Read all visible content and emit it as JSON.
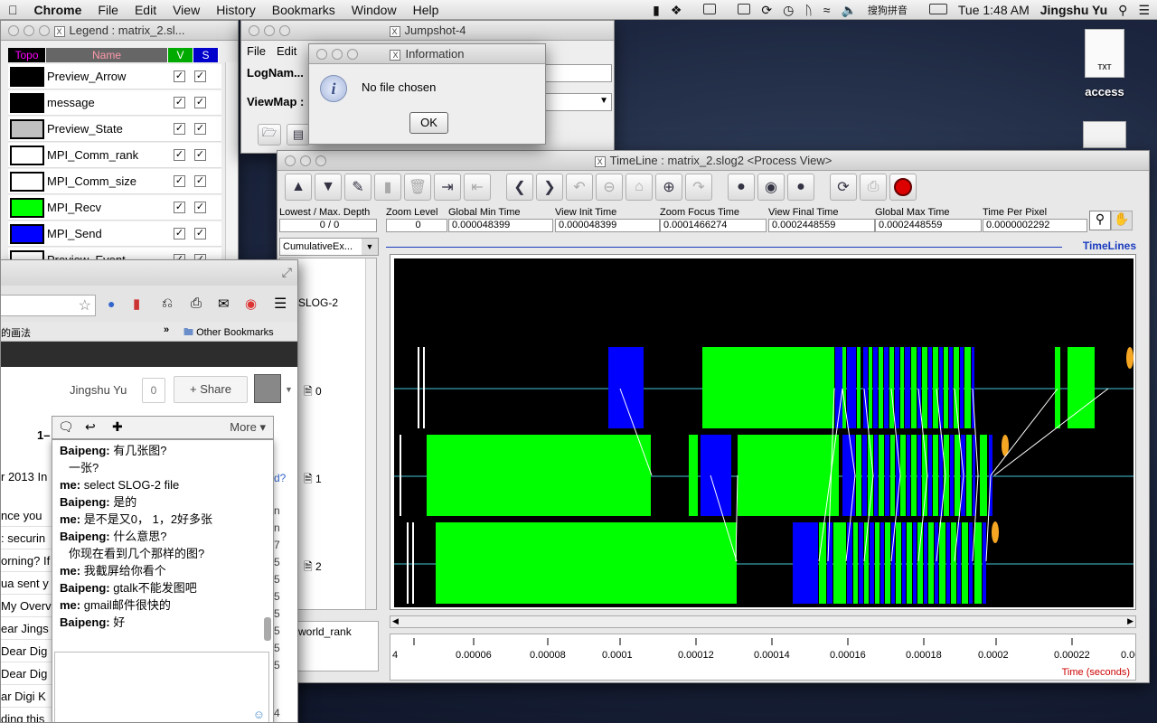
{
  "menubar": {
    "app": "Chrome",
    "items": [
      "File",
      "Edit",
      "View",
      "History",
      "Bookmarks",
      "Window",
      "Help"
    ],
    "right": {
      "input_method": "搜狗拼音",
      "time": "Tue 1:48 AM",
      "user": "Jingshu Yu"
    }
  },
  "desktop": {
    "icons": [
      {
        "label": "access",
        "type": "TXT"
      }
    ]
  },
  "legend": {
    "title": "Legend : matrix_2.sl...",
    "headers": {
      "topo": "Topo",
      "name": "Name",
      "v": "V",
      "s": "S"
    },
    "rows": [
      {
        "name": "Preview_Arrow",
        "color": "#000000"
      },
      {
        "name": "message",
        "color": "#000000"
      },
      {
        "name": "Preview_State",
        "color": "#c0c0c0"
      },
      {
        "name": "MPI_Comm_rank",
        "color": "#ffffff"
      },
      {
        "name": "MPI_Comm_size",
        "color": "#ffffff"
      },
      {
        "name": "MPI_Recv",
        "color": "#00ff00"
      },
      {
        "name": "MPI_Send",
        "color": "#0000ff"
      },
      {
        "name": "Preview_Event",
        "color": "#ffffff"
      }
    ]
  },
  "jumpshot": {
    "title": "Jumpshot-4",
    "menu": [
      "File",
      "Edit"
    ],
    "logname_label": "LogNam...",
    "viewmap_label": "ViewMap :"
  },
  "info": {
    "title": "Information",
    "message": "No file chosen",
    "ok": "OK"
  },
  "timeline": {
    "title": "TimeLine : matrix_2.slog2  <Process View>",
    "fields": {
      "depth": {
        "label": "Lowest / Max. Depth",
        "value": "0 / 0"
      },
      "zoom": {
        "label": "Zoom Level",
        "value": "0"
      },
      "gmin": {
        "label": "Global Min Time",
        "value": "0.000048399"
      },
      "vinit": {
        "label": "View  Init Time",
        "value": "0.000048399"
      },
      "focus": {
        "label": "Zoom Focus Time",
        "value": "0.0001466274"
      },
      "vfinal": {
        "label": "View Final Time",
        "value": "0.0002448559"
      },
      "gmax": {
        "label": "Global Max Time",
        "value": "0.0002448559"
      },
      "tpp": {
        "label": "Time Per Pixel",
        "value": "0.0000002292"
      }
    },
    "tree_select": "CumulativeEx...",
    "tree_label": "SLOG-2",
    "ranks": [
      "0",
      "1",
      "2"
    ],
    "world_rank": "world_rank",
    "canvas_label": "TimeLines",
    "axis_title": "Time (seconds)",
    "axis_ticks": [
      "4",
      "0.00006",
      "0.00008",
      "0.0001",
      "0.00012",
      "0.00014",
      "0.00016",
      "0.00018",
      "0.0002",
      "0.00022",
      "0.00"
    ]
  },
  "browser": {
    "bookmark_text": "的画法",
    "other_bookmarks": "Other Bookmarks",
    "user": "Jingshu Yu",
    "plus_count": "0",
    "share": "+ Share",
    "page_frag": "1–",
    "more": "More ▾",
    "side_rows": [
      "r 2013 In",
      "nce you",
      ": securin",
      "orning? If",
      "ua sent y",
      "My Overv",
      "ear Jings",
      "Dear Dig",
      "Dear Dig",
      "ar Digi K",
      "ding this"
    ],
    "right_digits": [
      "n",
      "n",
      "7",
      "5",
      "5",
      "5",
      "5",
      "5",
      "5",
      "5",
      "4"
    ],
    "chat": [
      {
        "who": "Baipeng:",
        "text": "有几张图?"
      },
      {
        "who": "",
        "text": "一张?"
      },
      {
        "who": "me:",
        "text": "select SLOG-2 file"
      },
      {
        "who": "Baipeng:",
        "text": "是的"
      },
      {
        "who": "me:",
        "text": "是不是又0， 1，2好多张"
      },
      {
        "who": "Baipeng:",
        "text": "什么意思?"
      },
      {
        "who": "",
        "text": "你现在看到几个那样的图?"
      },
      {
        "who": "me:",
        "text": "我截屏给你看个"
      },
      {
        "who": "Baipeng:",
        "text": "gtalk不能发图吧"
      },
      {
        "who": "me:",
        "text": "gmail邮件很快的"
      },
      {
        "who": "Baipeng:",
        "text": "好"
      }
    ]
  }
}
